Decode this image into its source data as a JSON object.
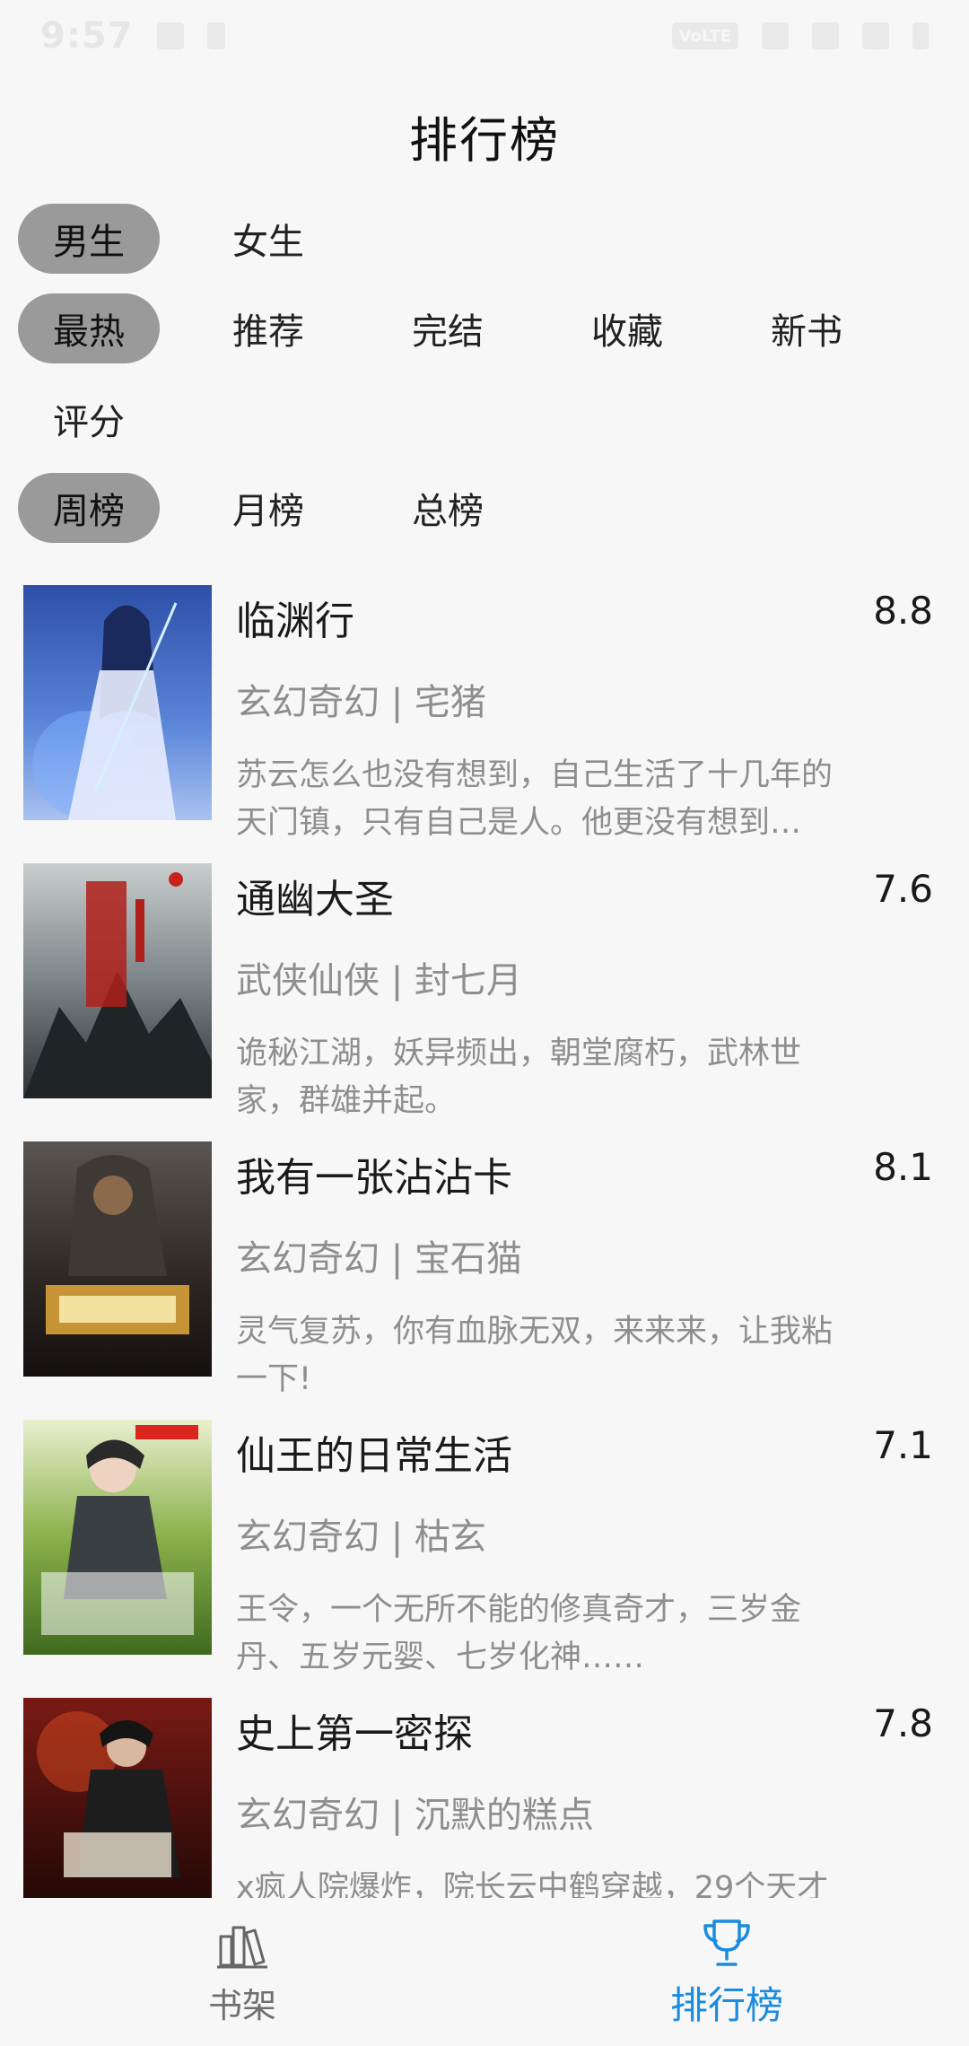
{
  "status_bar": {
    "time": "9:57",
    "battery": "VoLTE"
  },
  "header": {
    "title": "排行榜"
  },
  "filters": {
    "gender": [
      {
        "label": "男生",
        "active": true
      },
      {
        "label": "女生",
        "active": false
      }
    ],
    "category": [
      {
        "label": "最热",
        "active": true
      },
      {
        "label": "推荐",
        "active": false
      },
      {
        "label": "完结",
        "active": false
      },
      {
        "label": "收藏",
        "active": false
      },
      {
        "label": "新书",
        "active": false
      },
      {
        "label": "评分",
        "active": false
      }
    ],
    "period": [
      {
        "label": "周榜",
        "active": true
      },
      {
        "label": "月榜",
        "active": false
      },
      {
        "label": "总榜",
        "active": false
      }
    ]
  },
  "books": [
    {
      "title": "临渊行",
      "score": "8.8",
      "meta": "玄幻奇幻 | 宅猪",
      "desc": "苏云怎么也没有想到，自己生活了十几年的天门镇，只有自己是人。他更没有想到…"
    },
    {
      "title": "通幽大圣",
      "score": "7.6",
      "meta": "武侠仙侠 | 封七月",
      "desc": "诡秘江湖，妖异频出，朝堂腐朽，武林世家，群雄并起。"
    },
    {
      "title": "我有一张沾沾卡",
      "score": "8.1",
      "meta": "玄幻奇幻 | 宝石猫",
      "desc": "灵气复苏，你有血脉无双，来来来，让我粘一下!"
    },
    {
      "title": "仙王的日常生活",
      "score": "7.1",
      "meta": "玄幻奇幻 | 枯玄",
      "desc": "王令，一个无所不能的修真奇才，三岁金丹、五岁元婴、七岁化神……"
    },
    {
      "title": "史上第一密探",
      "score": "7.8",
      "meta": "玄幻奇幻 | 沉默的糕点",
      "desc": "x疯人院爆炸，院长云中鹤穿越，29个天才"
    }
  ],
  "bottom_nav": [
    {
      "label": "书架",
      "icon": "bookshelf-icon",
      "active": false
    },
    {
      "label": "排行榜",
      "icon": "trophy-icon",
      "active": true
    }
  ],
  "colors": {
    "accent": "#1a8ce0",
    "chip_active": "#9a9a9a",
    "muted_text": "#8e8e8e"
  }
}
